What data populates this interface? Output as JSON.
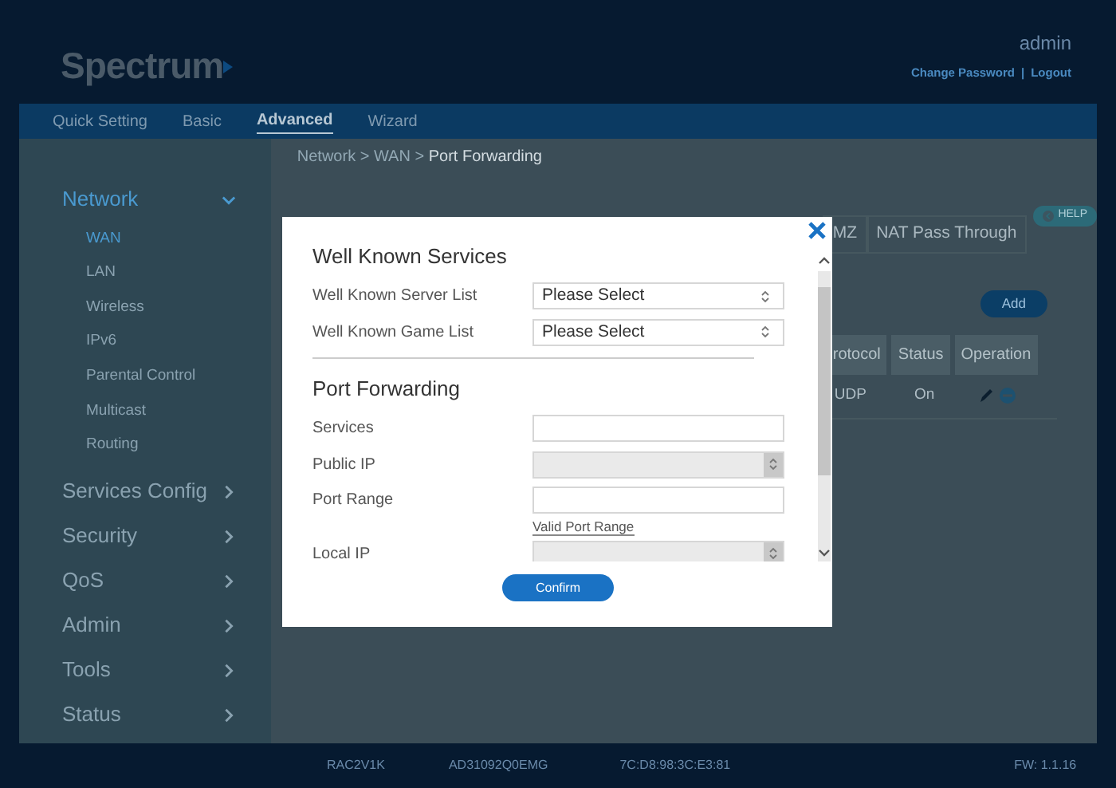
{
  "header": {
    "logo": "Spectrum",
    "user": "admin",
    "links": [
      "Change Password",
      "Logout"
    ],
    "link_separator": "|"
  },
  "nav": [
    {
      "label": "Quick Setting",
      "selected": false
    },
    {
      "label": "Basic",
      "selected": false
    },
    {
      "label": "Advanced",
      "selected": true
    },
    {
      "label": "Wizard",
      "selected": false
    }
  ],
  "sidebar": [
    {
      "label": "Network",
      "expanded": true,
      "children": [
        {
          "label": "WAN",
          "selected": true
        },
        {
          "label": "LAN",
          "selected": false
        },
        {
          "label": "Wireless",
          "selected": false
        },
        {
          "label": "IPv6",
          "selected": false
        },
        {
          "label": "Parental Control",
          "selected": false
        },
        {
          "label": "Multicast",
          "selected": false
        },
        {
          "label": "Routing",
          "selected": false
        }
      ]
    },
    {
      "label": "Services Config",
      "expanded": false
    },
    {
      "label": "Security",
      "expanded": false
    },
    {
      "label": "QoS",
      "expanded": false
    },
    {
      "label": "Admin",
      "expanded": false
    },
    {
      "label": "Tools",
      "expanded": false
    },
    {
      "label": "Status",
      "expanded": false
    }
  ],
  "breadcrumb": {
    "parts": [
      "Network",
      "WAN",
      "Port Forwarding"
    ],
    "separator": ">"
  },
  "tabs": [
    {
      "label": "MZ",
      "selected": false
    },
    {
      "label": "NAT Pass Through",
      "selected": false
    }
  ],
  "help": "HELP",
  "add": "Add",
  "table": {
    "columns": [
      "rotocol",
      "Status",
      "Operation"
    ],
    "rows": [
      {
        "cells": [
          "UDP",
          "On"
        ]
      }
    ]
  },
  "dialog": {
    "sections": [
      {
        "title": "Well Known Services",
        "fields": [
          {
            "kind": "select",
            "label": "Well Known Server List",
            "value": "Please Select",
            "disabled": false
          },
          {
            "kind": "select",
            "label": "Well Known Game List",
            "value": "Please Select",
            "disabled": false
          }
        ]
      },
      {
        "title": "Port Forwarding",
        "fields": [
          {
            "kind": "text",
            "label": "Services"
          },
          {
            "kind": "select",
            "label": "Public IP",
            "disabled": true
          },
          {
            "kind": "text",
            "label": "Port Range",
            "hint": "Valid Port Range"
          },
          {
            "kind": "select",
            "label": "Local IP",
            "disabled": true
          }
        ]
      }
    ],
    "confirm": "Confirm"
  },
  "footer": [
    "RAC2V1K",
    "AD31092Q0EMG",
    "7C:D8:98:3C:E3:81",
    "FW: 1.1.16"
  ]
}
